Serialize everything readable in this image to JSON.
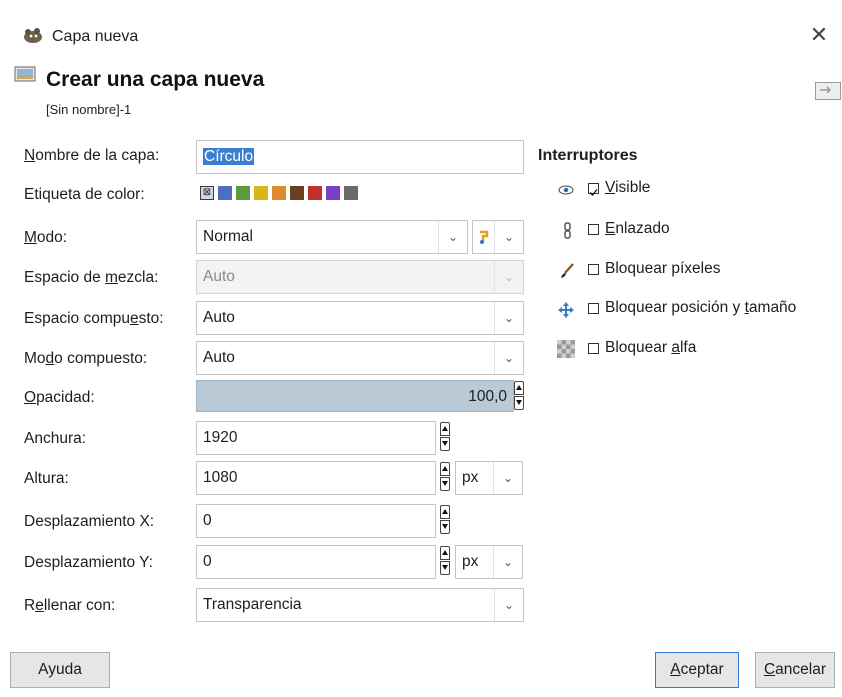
{
  "window": {
    "title": "Capa nueva",
    "close_glyph": "✕"
  },
  "header": {
    "title": "Crear una capa nueva",
    "subtitle": "[Sin nombre]-1"
  },
  "form": {
    "layer_name": {
      "label_u": "N",
      "label_rest": "ombre de la capa:",
      "value": "Círculo"
    },
    "color_tag": {
      "label": "Etiqueta de color:",
      "colors": [
        "none",
        "#4c6fc4",
        "#5e9a3a",
        "#d8b51d",
        "#e08a2f",
        "#6b3e24",
        "#c12f2f",
        "#7a3fc4",
        "#6a6a6a"
      ]
    },
    "mode": {
      "label_u": "M",
      "label_rest": "odo:",
      "value": "Normal"
    },
    "blend_space": {
      "label_pre": "Espacio de ",
      "label_u": "m",
      "label_rest": "ezcla:",
      "value": "Auto"
    },
    "composite_space": {
      "label_pre": "Espacio compu",
      "label_u": "e",
      "label_rest": "sto:",
      "value": "Auto"
    },
    "composite_mode": {
      "label_pre": "Mo",
      "label_u": "d",
      "label_rest": "o compuesto:",
      "value": "Auto"
    },
    "opacity": {
      "label_u": "O",
      "label_rest": "pacidad:",
      "value": "100,0"
    },
    "width": {
      "label": "Anchura:",
      "value": "1920"
    },
    "height": {
      "label": "Altura:",
      "value": "1080"
    },
    "size_unit": "px",
    "offset_x": {
      "label": "Desplazamiento X:",
      "value": "0"
    },
    "offset_y": {
      "label": "Desplazamiento Y:",
      "value": "0"
    },
    "offset_unit": "px",
    "fill": {
      "label_pre": "R",
      "label_u": "e",
      "label_rest": "llenar con:",
      "value": "Transparencia"
    }
  },
  "switches": {
    "title": "Interruptores",
    "items": [
      {
        "label_pre": "",
        "label_u": "V",
        "label_rest": "isible",
        "checked": true,
        "icon": "eye-icon"
      },
      {
        "label_pre": "",
        "label_u": "E",
        "label_rest": "nlazado",
        "checked": false,
        "icon": "chain-icon"
      },
      {
        "label_pre": "Bloquear píxeles",
        "label_u": "",
        "label_rest": "",
        "checked": false,
        "icon": "brush-icon"
      },
      {
        "label_pre": "Bloquear posición y ",
        "label_u": "t",
        "label_rest": "amaño",
        "checked": false,
        "icon": "move-icon"
      },
      {
        "label_pre": "Bloquear ",
        "label_u": "a",
        "label_rest": "lfa",
        "checked": false,
        "icon": "checker-icon"
      }
    ]
  },
  "buttons": {
    "help": "Ayuda",
    "ok_u": "A",
    "ok_rest": "ceptar",
    "cancel_u": "C",
    "cancel_rest": "ancelar"
  }
}
